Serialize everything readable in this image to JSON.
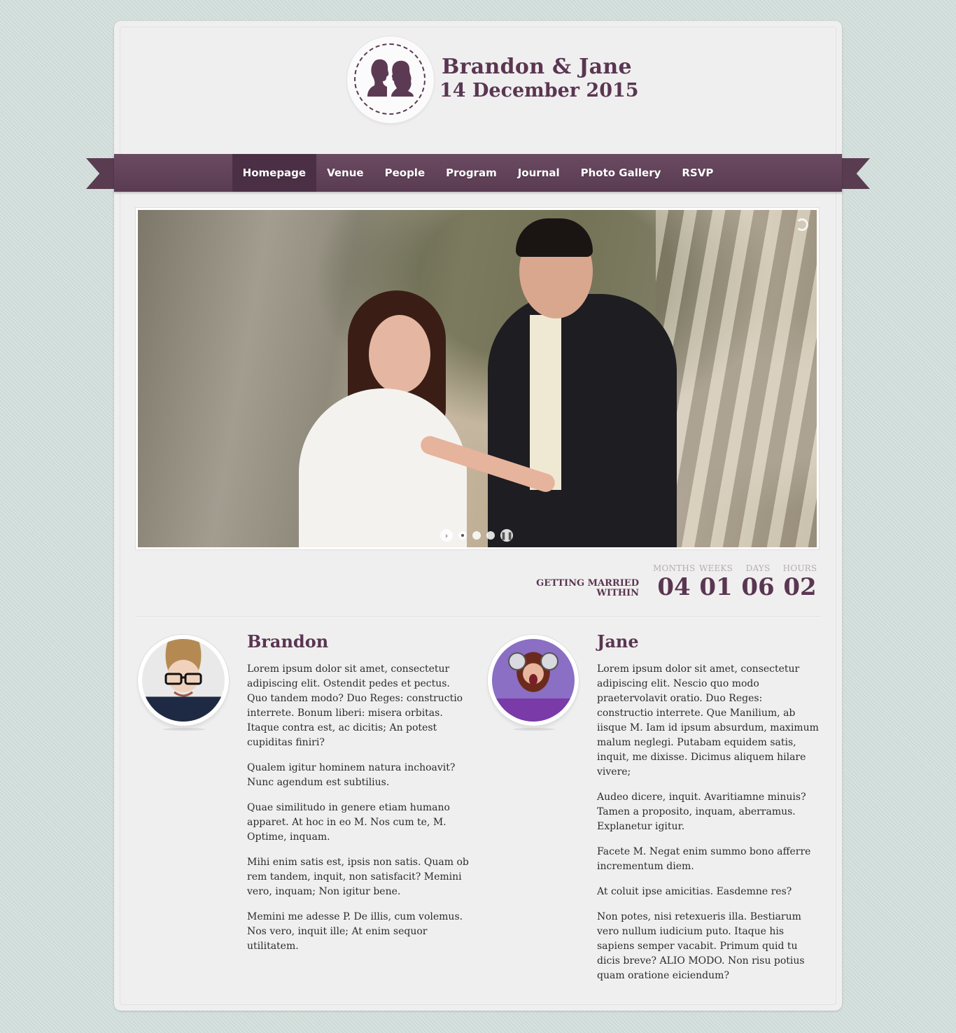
{
  "header": {
    "title": "Brandon & Jane",
    "date": "14 December 2015",
    "logo_icon": "couple-silhouette-icon"
  },
  "nav": {
    "items": [
      {
        "label": "Homepage",
        "active": true
      },
      {
        "label": "Venue",
        "active": false
      },
      {
        "label": "People",
        "active": false
      },
      {
        "label": "Program",
        "active": false
      },
      {
        "label": "Journal",
        "active": false
      },
      {
        "label": "Photo Gallery",
        "active": false
      },
      {
        "label": "RSVP",
        "active": false
      }
    ]
  },
  "slider": {
    "icons": {
      "next": "chevron-right-icon",
      "pause": "pause-icon"
    },
    "dots": 3,
    "active_dot": 0
  },
  "countdown": {
    "label_line1": "GETTING MARRIED",
    "label_line2": "WITHIN",
    "units": [
      {
        "label": "MONTHS",
        "value": "04"
      },
      {
        "label": "WEEKS",
        "value": "01"
      },
      {
        "label": "DAYS",
        "value": "06"
      },
      {
        "label": "HOURS",
        "value": "02"
      }
    ]
  },
  "profiles": [
    {
      "name": "Brandon",
      "paragraphs": [
        "Lorem ipsum dolor sit amet, consectetur adipiscing elit. Ostendit pedes et pectus. Quo tandem modo? Duo Reges: constructio interrete. Bonum liberi: misera orbitas. Itaque contra est, ac dicitis; An potest cupiditas finiri?",
        "Qualem igitur hominem natura inchoavit? Nunc agendum est subtilius.",
        "Quae similitudo in genere etiam humano apparet. At hoc in eo M. Nos cum te, M. Optime, inquam.",
        "Mihi enim satis est, ipsis non satis. Quam ob rem tandem, inquit, non satisfacit? Memini vero, inquam; Non igitur bene.",
        "Memini me adesse P. De illis, cum volemus. Nos vero, inquit ille; At enim sequor utilitatem."
      ]
    },
    {
      "name": "Jane",
      "paragraphs": [
        "Lorem ipsum dolor sit amet, consectetur adipiscing elit. Nescio quo modo praetervolavit oratio. Duo Reges: constructio interrete. Que Manilium, ab iisque M. Iam id ipsum absurdum, maximum malum neglegi. Putabam equidem satis, inquit, me dixisse. Dicimus aliquem hilare vivere;",
        "Audeo dicere, inquit. Avaritiamne minuis? Tamen a proposito, inquam, aberramus. Explanetur igitur.",
        "Facete M. Negat enim summo bono afferre incrementum diem.",
        "At coluit ipse amicitias. Easdemne res?",
        "Non potes, nisi retexueris illa. Bestiarum vero nullum iudicium puto. Itaque his sapiens semper vacabit. Primum quid tu dicis breve? ALIO MODO. Non risu potius quam oratione eiciendum?"
      ]
    }
  ],
  "colors": {
    "brand": "#5a3652",
    "ribbon": "#5a3c52",
    "page_background": "#d2dedb"
  }
}
